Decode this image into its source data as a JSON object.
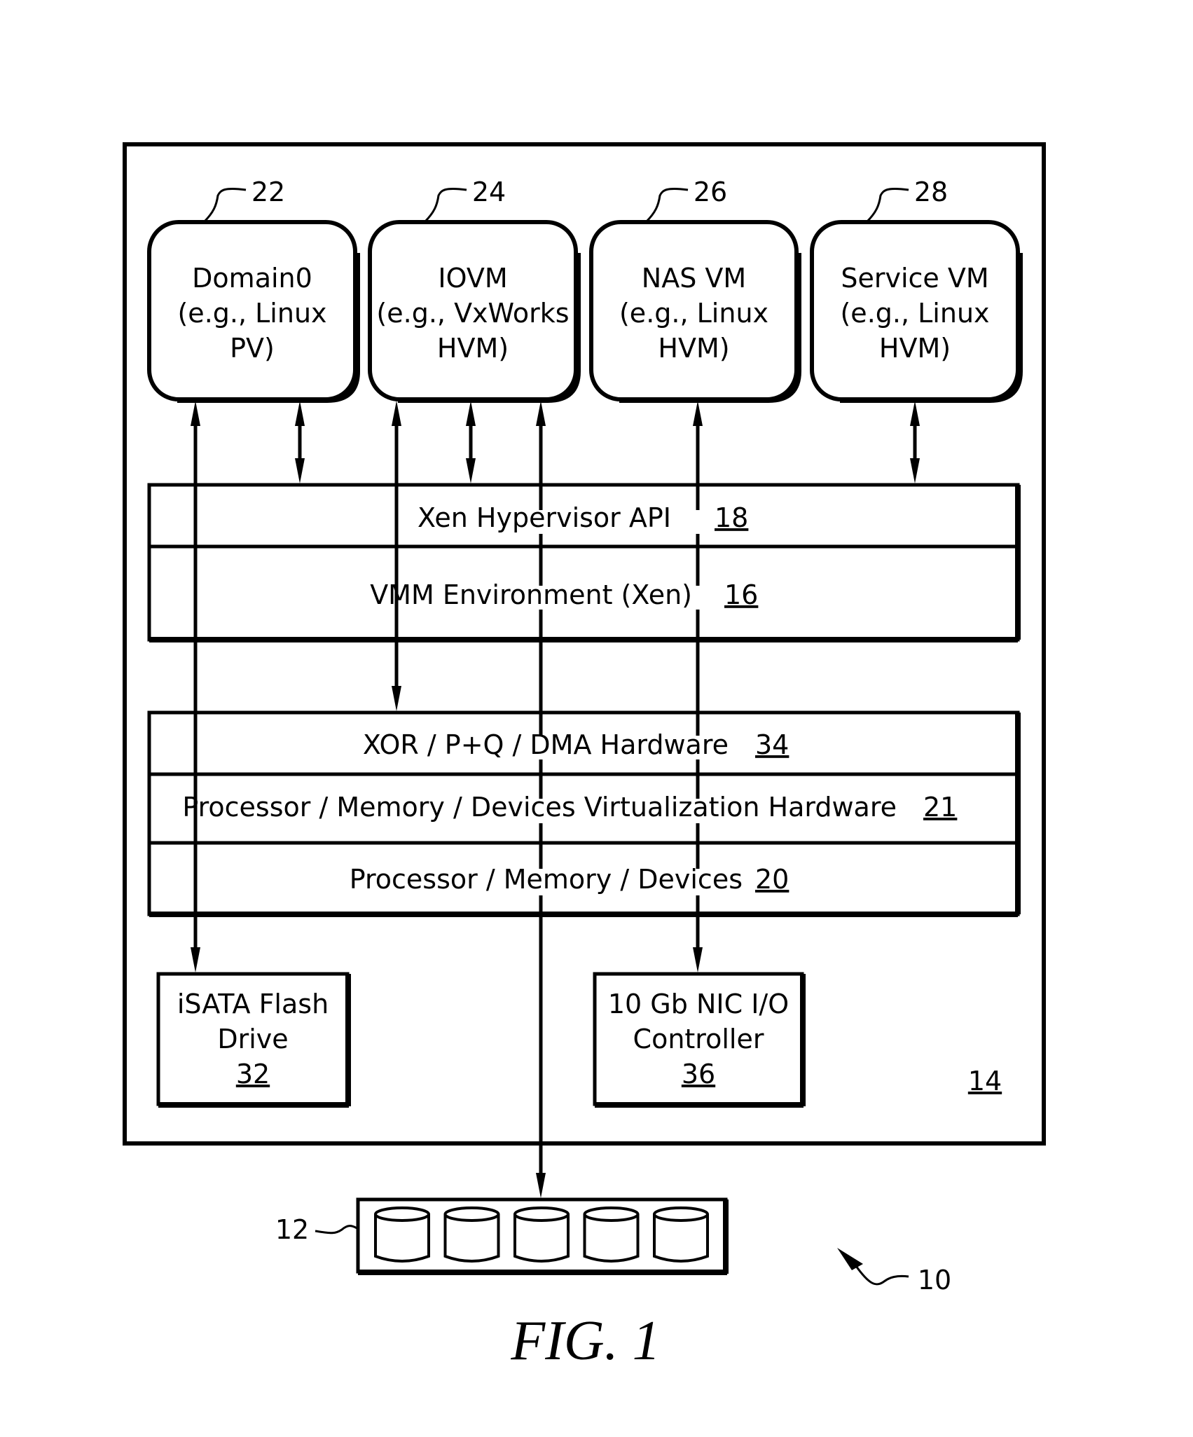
{
  "figure": {
    "caption": "FIG. 1",
    "system_ref": "10",
    "host_ref": "14",
    "storage_ref": "12"
  },
  "vms": [
    {
      "ref": "22",
      "lines": [
        "Domain0",
        "(e.g., Linux",
        "PV)"
      ]
    },
    {
      "ref": "24",
      "lines": [
        "IOVM",
        "(e.g., VxWorks",
        "HVM)"
      ]
    },
    {
      "ref": "26",
      "lines": [
        "NAS VM",
        "(e.g., Linux",
        "HVM)"
      ]
    },
    {
      "ref": "28",
      "lines": [
        "Service VM",
        "(e.g., Linux",
        "HVM)"
      ]
    }
  ],
  "hypervisor_layers": [
    {
      "label": "Xen Hypervisor API",
      "ref": "18"
    },
    {
      "label": "VMM Environment (Xen)",
      "ref": "16"
    }
  ],
  "hardware_layers": [
    {
      "label": "XOR / P+Q / DMA Hardware",
      "ref": "34"
    },
    {
      "label": "Processor / Memory / Devices Virtualization Hardware",
      "ref": "21"
    },
    {
      "label": "Processor / Memory / Devices",
      "ref": "20"
    }
  ],
  "devices": [
    {
      "lines": [
        "iSATA Flash",
        "Drive"
      ],
      "ref": "32"
    },
    {
      "lines": [
        "10 Gb NIC I/O",
        "Controller"
      ],
      "ref": "36"
    }
  ],
  "storage": {
    "disk_count": 5
  }
}
